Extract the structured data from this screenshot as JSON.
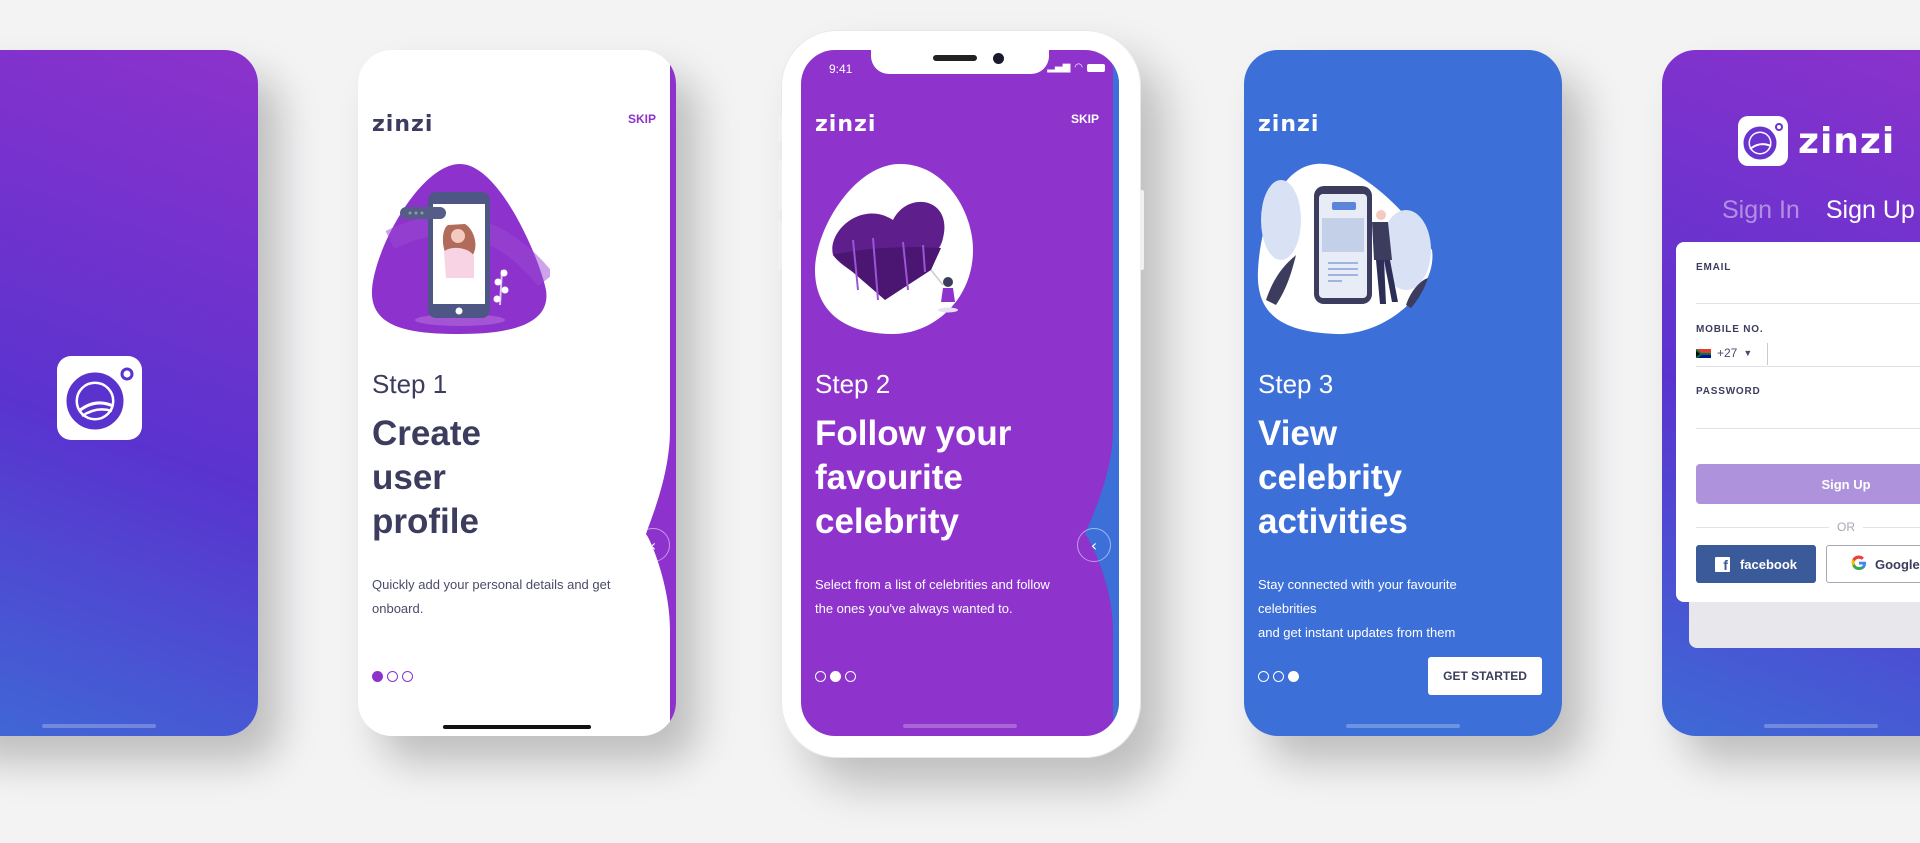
{
  "brand": {
    "name": "zinzi"
  },
  "splash": {
    "logo_icon": "zinzi-camera-logo-icon"
  },
  "steps": [
    {
      "step_label": "Step 1",
      "title_lines": [
        "Create",
        "user",
        "profile"
      ],
      "description_lines": [
        "Quickly add your personal details and get",
        "onboard."
      ],
      "skip_label": "SKIP",
      "illustration": "woman-in-phone-illustration",
      "active_dot": 1,
      "total_dots": 3
    },
    {
      "step_label": "Step 2",
      "title_lines": [
        "Follow your",
        "favourite",
        "celebrity"
      ],
      "description_lines": [
        "Select from a list of celebrities and follow",
        "the ones you've always wanted to."
      ],
      "skip_label": "SKIP",
      "illustration": "heart-with-woman-illustration",
      "active_dot": 2,
      "total_dots": 3
    },
    {
      "step_label": "Step 3",
      "title_lines": [
        "View",
        "celebrity",
        "activities"
      ],
      "description_lines": [
        "Stay connected with your favourite celebrities",
        "and get instant updates from them"
      ],
      "cta_label": "GET STARTED",
      "illustration": "man-beside-phone-illustration",
      "active_dot": 3,
      "total_dots": 3
    }
  ],
  "status_bar": {
    "time": "9:41"
  },
  "signup": {
    "tabs": [
      {
        "label": "Sign In",
        "active": false
      },
      {
        "label": "Sign Up",
        "active": true
      }
    ],
    "fields": {
      "email_label": "EMAIL",
      "email_value": "",
      "mobile_label": "MOBILE NO.",
      "country_code": "+27",
      "country_flag": "south-africa-flag",
      "mobile_value": "",
      "password_label": "PASSWORD",
      "password_value": ""
    },
    "submit_label": "Sign Up",
    "or_label": "OR",
    "facebook_label": "facebook",
    "google_label": "Google"
  },
  "colors": {
    "purple": "#8e33cb",
    "blue": "#3c70d8",
    "dark_text": "#3c3d5e",
    "signup_button": "#ae93dc",
    "facebook": "#3b5a9a"
  }
}
